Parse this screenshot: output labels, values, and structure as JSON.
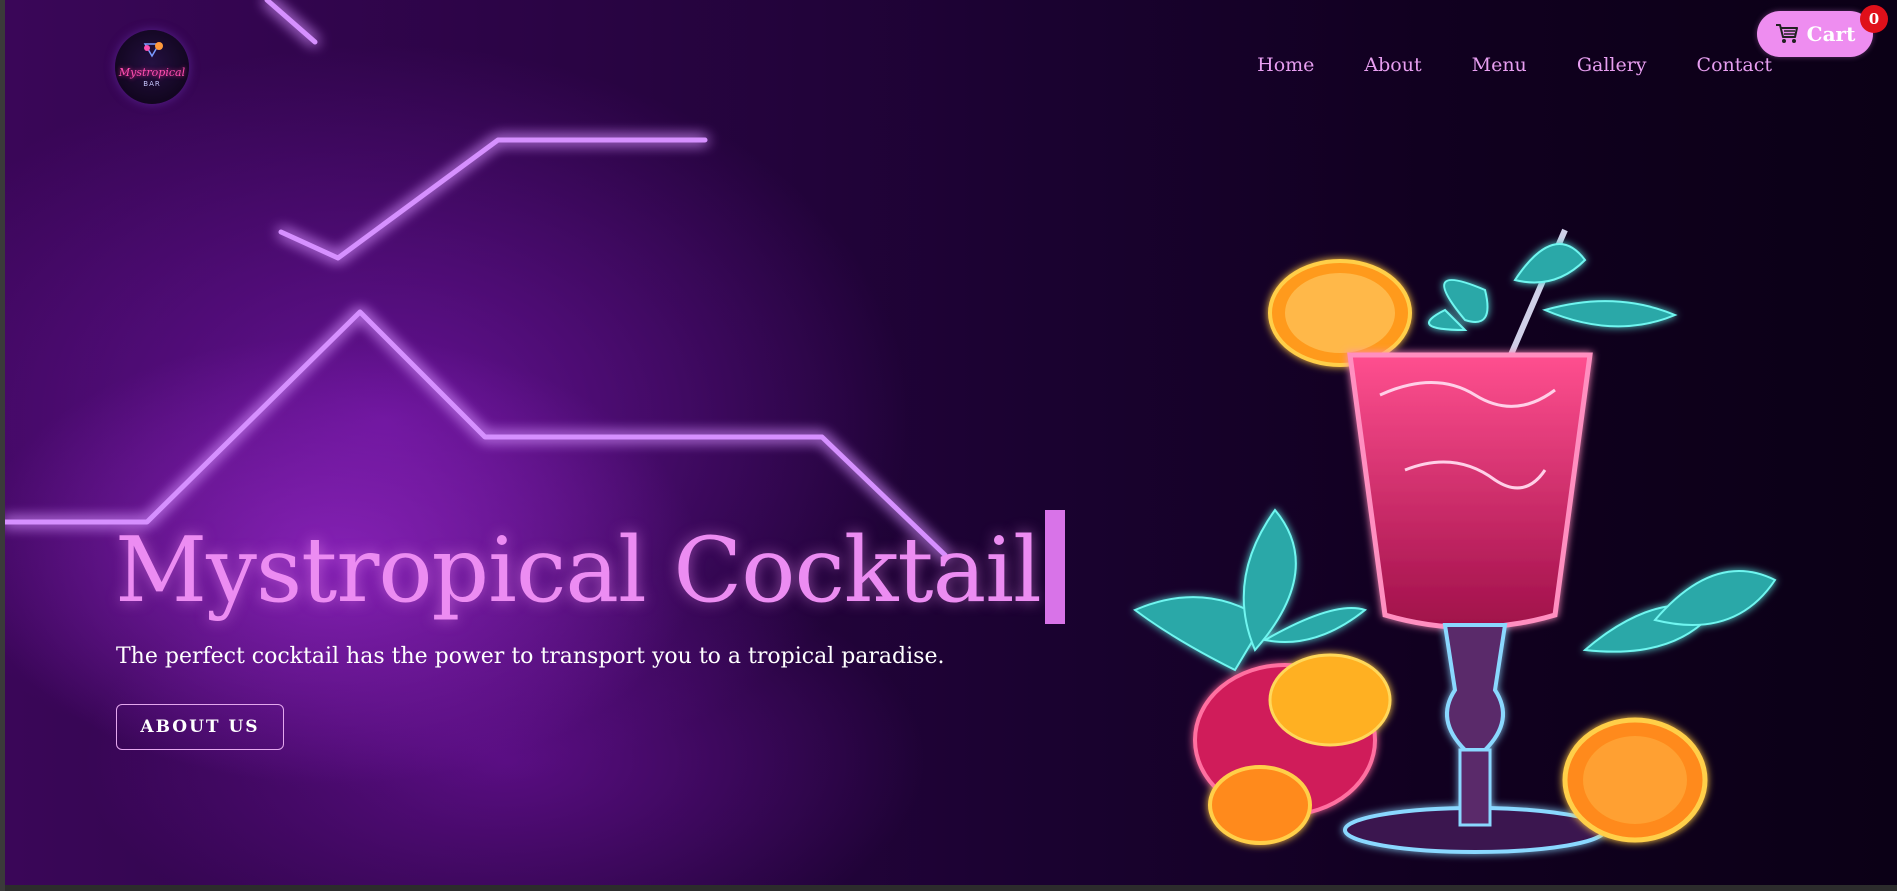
{
  "brand": {
    "logo_text": "Mystropical",
    "logo_subtext": "BAR"
  },
  "nav": {
    "items": [
      {
        "label": "Home"
      },
      {
        "label": "About"
      },
      {
        "label": "Menu"
      },
      {
        "label": "Gallery"
      },
      {
        "label": "Contact"
      }
    ]
  },
  "cart": {
    "label": "Cart",
    "count": "0",
    "icon": "cart-icon"
  },
  "hero": {
    "title": "Mystropical Cocktail",
    "subtitle": "The perfect cocktail has the power to transport you to a tropical paradise.",
    "button_label": "ABOUT US"
  },
  "colors": {
    "accent_pink": "#ec8cf2",
    "background_purple": "#2a0444",
    "badge_red": "#e0101a",
    "neon_purple": "#c25cff"
  }
}
